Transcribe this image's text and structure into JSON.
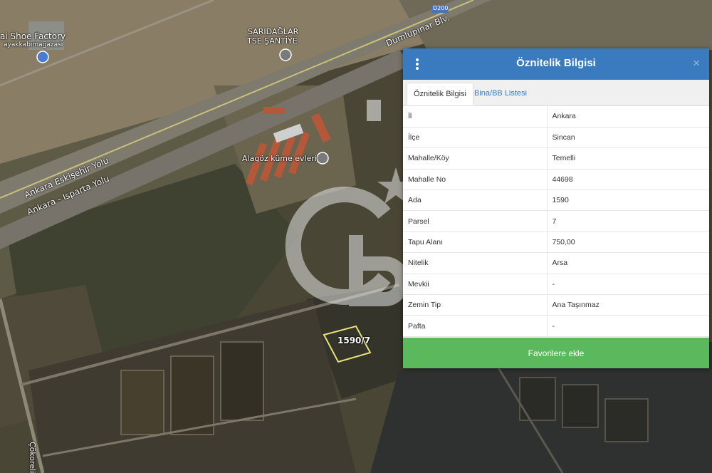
{
  "map": {
    "road_badge": "D200",
    "labels": {
      "shoe_factory": "ai Shoe Factory",
      "shoe_factory_sub": "ayakkabımağazası",
      "saridaglar": "SARIDAĞLAR",
      "tse_santiye": "TSE ŞANTİYE",
      "dumlupinar": "Dumlupınar Blv.",
      "eskisehir": "Ankara Eskişehir Yolu",
      "isparta": "Ankara - Isparta Yolu",
      "alagoz": "Alagöz küme evleri",
      "parcel": "1590/7",
      "cokoreli": "Çökoreli"
    },
    "watermark": "CB"
  },
  "panel": {
    "title": "Öznitelik Bilgisi",
    "close": "×",
    "tabs": [
      "Öznitelik Bilgisi",
      "Bina/BB Listesi"
    ],
    "rows": [
      {
        "key": "İl",
        "value": "Ankara"
      },
      {
        "key": "İlçe",
        "value": "Sincan"
      },
      {
        "key": "Mahalle/Köy",
        "value": "Temelli"
      },
      {
        "key": "Mahalle No",
        "value": "44698"
      },
      {
        "key": "Ada",
        "value": "1590"
      },
      {
        "key": "Parsel",
        "value": "7"
      },
      {
        "key": "Tapu Alanı",
        "value": "750,00"
      },
      {
        "key": "Nitelik",
        "value": "Arsa"
      },
      {
        "key": "Mevkii",
        "value": "-"
      },
      {
        "key": "Zemin Tip",
        "value": "Ana Taşınmaz"
      },
      {
        "key": "Pafta",
        "value": "-"
      }
    ],
    "favorite_label": "Favorilere ekle"
  },
  "colors": {
    "header": "#3a7bbf",
    "favorite": "#5cb85c"
  }
}
